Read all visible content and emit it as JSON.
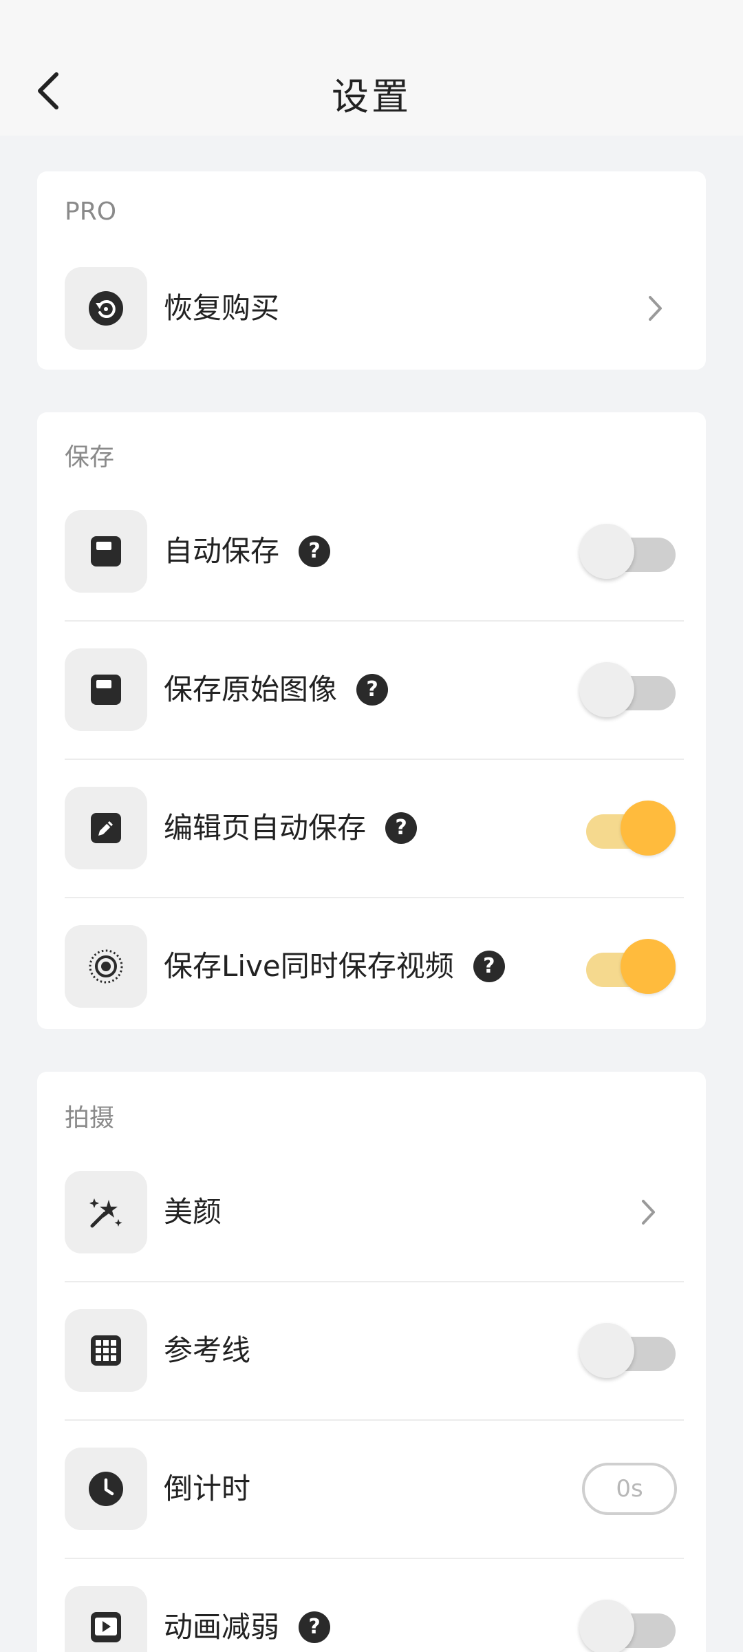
{
  "header": {
    "title": "设置"
  },
  "sections": {
    "pro": {
      "label": "PRO",
      "restore": {
        "label": "恢复购买",
        "icon": "restore-icon"
      }
    },
    "save": {
      "label": "保存",
      "auto_save": {
        "label": "自动保存",
        "on": false,
        "icon": "save-icon"
      },
      "save_original": {
        "label": "保存原始图像",
        "on": false,
        "icon": "save-icon"
      },
      "edit_auto_save": {
        "label": "编辑页自动保存",
        "on": true,
        "icon": "edit-icon"
      },
      "save_live_video": {
        "label": "保存Live同时保存视频",
        "on": true,
        "icon": "live-photo-icon"
      }
    },
    "shoot": {
      "label": "拍摄",
      "beauty": {
        "label": "美颜",
        "icon": "magic-wand-icon"
      },
      "grid": {
        "label": "参考线",
        "on": false,
        "icon": "grid-icon"
      },
      "timer": {
        "label": "倒计时",
        "value": "0s",
        "icon": "clock-icon"
      },
      "reduce_motion": {
        "label": "动画减弱",
        "on": false,
        "icon": "play-icon"
      }
    }
  },
  "help_glyph": "?",
  "colors": {
    "accent": "#ffbb3d",
    "accent_track": "#f5d98e",
    "off_track": "#cfcfcf",
    "background": "#f2f3f5"
  }
}
